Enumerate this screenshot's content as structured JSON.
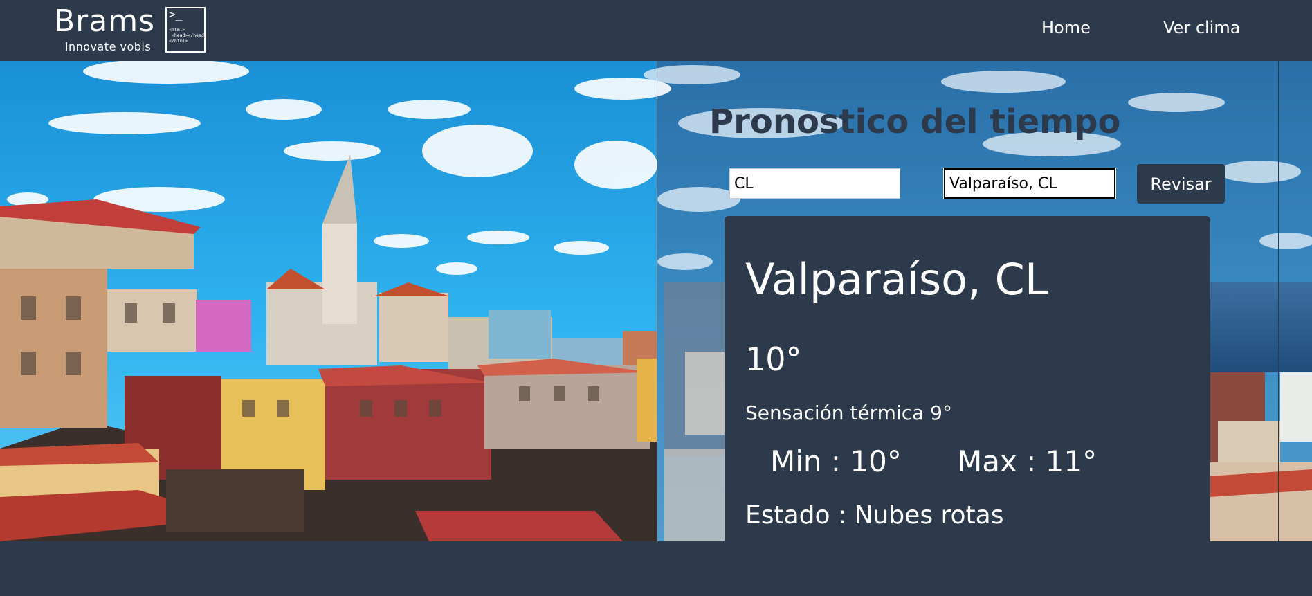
{
  "brand": {
    "name": "Brams",
    "tagline": "innovate vobis",
    "logo_prompt": ">_",
    "logo_code": "<html>\n <head></head>\n</html>"
  },
  "nav": {
    "home": "Home",
    "weather": "Ver clima"
  },
  "page": {
    "title": "Pronostico del tiempo"
  },
  "search": {
    "country_value": "CL",
    "city_value": "Valparaíso, CL",
    "submit_label": "Revisar"
  },
  "weather": {
    "location": "Valparaíso, CL",
    "temperature": "10°",
    "feels_like": "Sensación térmica 9°",
    "min": "Min : 10°",
    "max": "Max : 11°",
    "status": "Estado : Nubes rotas"
  },
  "colors": {
    "header_bg": "#2d3a4b",
    "card_bg": "#2d3a4b",
    "title_color": "#2d3a4b",
    "text_light": "#ffffff"
  }
}
